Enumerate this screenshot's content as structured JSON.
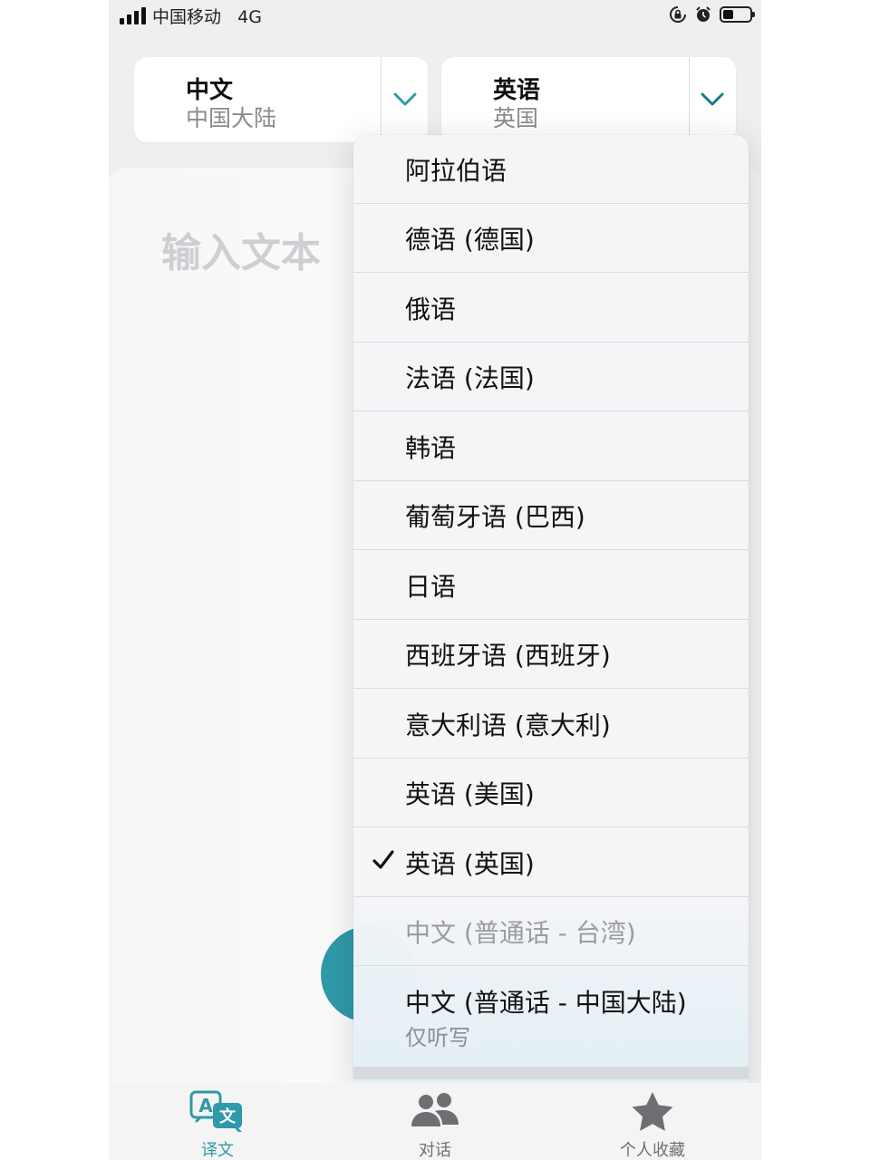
{
  "status_bar": {
    "carrier": "中国移动",
    "network": "4G",
    "battery_level": 0.4
  },
  "colors": {
    "accent": "#2f9aa8",
    "chevron": "#2f9aa8",
    "tab_active": "#2f9aa8",
    "tab_inactive": "#6e6e73"
  },
  "source_language": {
    "name": "中文",
    "region": "中国大陆",
    "icon": "chevron-down-icon"
  },
  "target_language": {
    "name": "英语",
    "region": "英国",
    "icon": "chevron-down-icon"
  },
  "input": {
    "placeholder": "输入文本"
  },
  "language_menu": {
    "items": [
      {
        "label": "阿拉伯语"
      },
      {
        "label": "德语 (德国)"
      },
      {
        "label": "俄语"
      },
      {
        "label": "法语 (法国)"
      },
      {
        "label": "韩语"
      },
      {
        "label": "葡萄牙语 (巴西)"
      },
      {
        "label": "日语"
      },
      {
        "label": "西班牙语 (西班牙)"
      },
      {
        "label": "意大利语 (意大利)"
      },
      {
        "label": "英语 (美国)"
      },
      {
        "label": "英语 (英国)",
        "selected": true
      },
      {
        "label": "中文 (普通话 - 台湾)",
        "disabled": true
      },
      {
        "label": "中文 (普通话 - 中国大陆)",
        "sublabel": "仅听写"
      }
    ]
  },
  "tabs": [
    {
      "label": "译文",
      "icon": "translate-icon",
      "active": true
    },
    {
      "label": "对话",
      "icon": "people-icon",
      "active": false
    },
    {
      "label": "个人收藏",
      "icon": "star-icon",
      "active": false
    }
  ]
}
